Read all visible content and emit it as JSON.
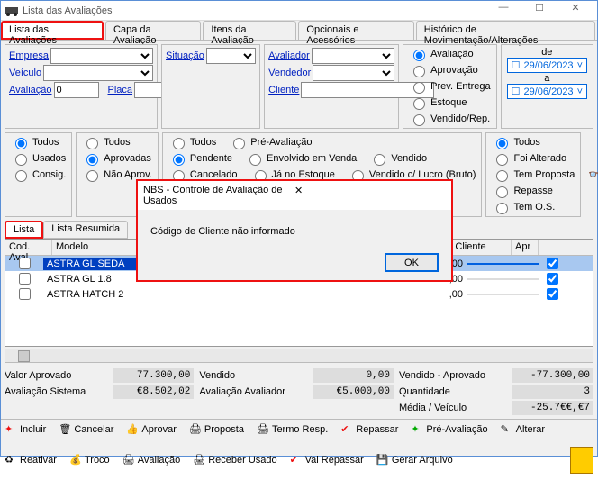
{
  "window": {
    "title": "Lista das Avaliações"
  },
  "tabs": [
    "Lista das Avaliações",
    "Capa da Avaliação",
    "Itens da Avaliação",
    "Opcionais e Acessórios",
    "Histórico de Movimentação/Alterações"
  ],
  "filters": {
    "empresa": "Empresa",
    "situacao": "Situação",
    "avaliador": "Avaliador",
    "veiculo": "Veículo",
    "vendedor": "Vendedor",
    "avaliacao": "Avaliação",
    "avaliacao_val": "0",
    "placa": "Placa",
    "cliente": "Cliente"
  },
  "type_radios": {
    "avaliacao": "Avaliação",
    "aprovacao": "Aprovação",
    "prev_entrega": "Prev. Entrega",
    "estoque": "Estoque",
    "vendido_rep": "Vendido/Rep."
  },
  "dates": {
    "de": "de",
    "de_val": "29/06/2023",
    "a": "a",
    "a_val": "29/06/2023"
  },
  "status1": {
    "todos": "Todos",
    "usados": "Usados",
    "consig": "Consig."
  },
  "status2": {
    "todos": "Todos",
    "aprovadas": "Aprovadas",
    "nao_aprov": "Não Aprov."
  },
  "status3": {
    "todos": "Todos",
    "pre": "Pré-Avaliação",
    "pendente": "Pendente",
    "envolvido": "Envolvido em Venda",
    "vendido": "Vendido",
    "cancelado": "Cancelado",
    "ja_estoque": "Já no Estoque",
    "vendido_lucro": "Vendido c/ Lucro (Bruto)"
  },
  "status4": {
    "todos": "Todos",
    "foi_alt": "Foi Alterado",
    "tem_prop": "Tem Proposta",
    "repasse": "Repasse",
    "tem_os": "Tem O.S."
  },
  "subtabs": {
    "lista": "Lista",
    "resumida": "Lista Resumida"
  },
  "grid": {
    "cols": {
      "cod": "Cod. Aval",
      "modelo": "Modelo",
      "cliente": "Cliente",
      "apr": "Apr"
    },
    "rows": [
      {
        "modelo": "ASTRA GL SEDA",
        "val": ",00",
        "cli": "",
        "apr": true
      },
      {
        "modelo": "ASTRA GL 1.8",
        "val": ",00",
        "cli": "",
        "apr": true
      },
      {
        "modelo": "ASTRA HATCH 2",
        "val": ",00",
        "cli": "",
        "apr": true
      }
    ]
  },
  "summary": {
    "valor_aprovado": "Valor Aprovado",
    "valor_aprovado_v": "77.300,00",
    "vendido": "Vendido",
    "vendido_v": "0,00",
    "vendido_aprovado": "Vendido - Aprovado",
    "vendido_aprovado_v": "-77.300,00",
    "aval_sistema": "Avaliação Sistema",
    "aval_sistema_v": "€8.502,02",
    "aval_avaliador": "Avaliação Avaliador",
    "aval_avaliador_v": "€5.000,00",
    "quantidade": "Quantidade",
    "quantidade_v": "3",
    "media_veiculo": "Média / Veículo",
    "media_veiculo_v": "-25.7€€,€7"
  },
  "toolbar": {
    "incluir": "Incluir",
    "cancelar": "Cancelar",
    "aprovar": "Aprovar",
    "proposta": "Proposta",
    "termo": "Termo Resp.",
    "repassar": "Repassar",
    "pre_aval": "Pré-Avaliação",
    "alterar": "Alterar",
    "reativar": "Reativar",
    "troco": "Troco",
    "avaliacao": "Avaliação",
    "receber": "Receber Usado",
    "vai_repassar": "Vai Repassar",
    "gerar": "Gerar Arquivo"
  },
  "dialog": {
    "title": "NBS - Controle de Avaliação de Usados",
    "message": "Código de Cliente não informado",
    "ok": "OK"
  }
}
